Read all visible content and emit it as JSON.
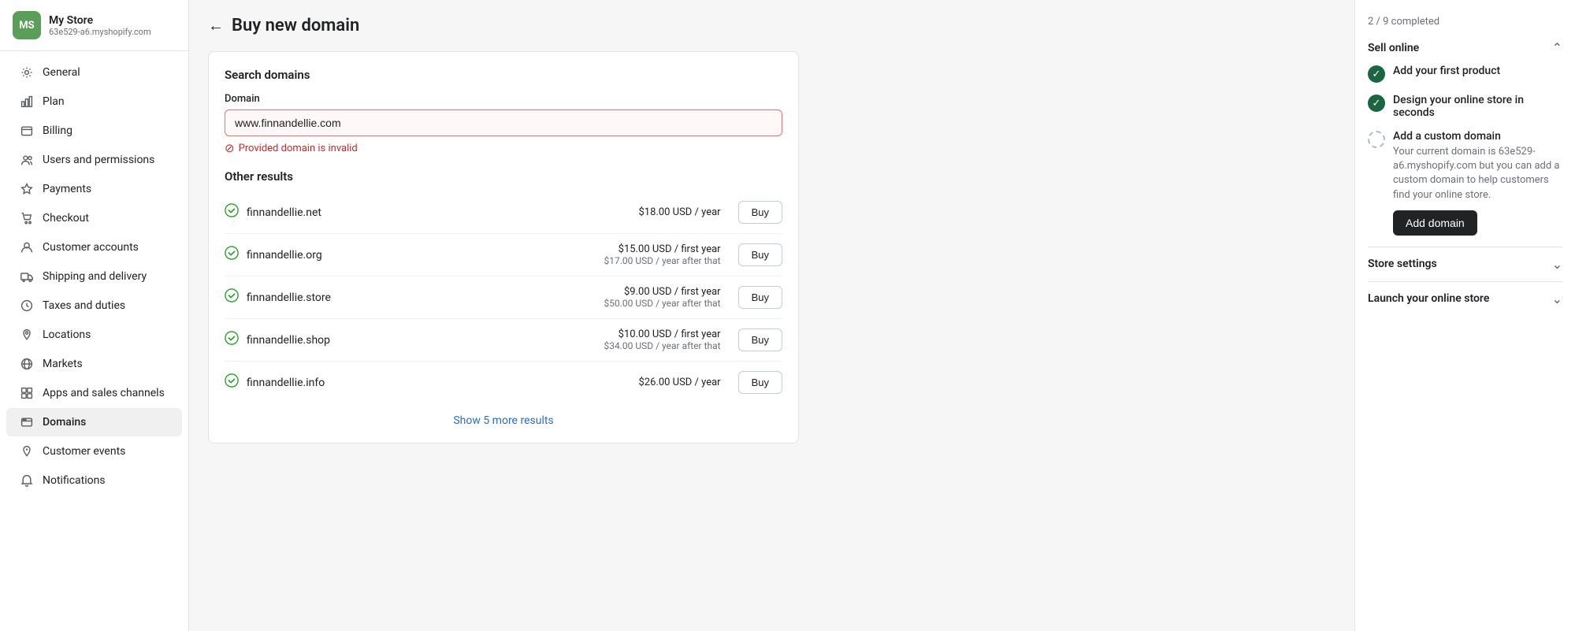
{
  "store": {
    "initials": "MS",
    "name": "My Store",
    "url": "63e529-a6.myshopify.com"
  },
  "sidebar": {
    "items": [
      {
        "id": "general",
        "label": "General",
        "icon": "gear"
      },
      {
        "id": "plan",
        "label": "Plan",
        "icon": "chart"
      },
      {
        "id": "billing",
        "label": "Billing",
        "icon": "billing"
      },
      {
        "id": "users",
        "label": "Users and permissions",
        "icon": "users"
      },
      {
        "id": "payments",
        "label": "Payments",
        "icon": "payments"
      },
      {
        "id": "checkout",
        "label": "Checkout",
        "icon": "checkout"
      },
      {
        "id": "customer-accounts",
        "label": "Customer accounts",
        "icon": "customer-accounts"
      },
      {
        "id": "shipping",
        "label": "Shipping and delivery",
        "icon": "shipping"
      },
      {
        "id": "taxes",
        "label": "Taxes and duties",
        "icon": "taxes"
      },
      {
        "id": "locations",
        "label": "Locations",
        "icon": "locations"
      },
      {
        "id": "markets",
        "label": "Markets",
        "icon": "markets"
      },
      {
        "id": "apps",
        "label": "Apps and sales channels",
        "icon": "apps"
      },
      {
        "id": "domains",
        "label": "Domains",
        "icon": "domains",
        "active": true
      },
      {
        "id": "customer-events",
        "label": "Customer events",
        "icon": "customer-events"
      },
      {
        "id": "notifications",
        "label": "Notifications",
        "icon": "notifications"
      }
    ]
  },
  "page": {
    "title": "Buy new domain",
    "back_label": "←"
  },
  "search_section": {
    "title": "Search domains",
    "field_label": "Domain",
    "input_value": "www.finnandellie.com",
    "input_placeholder": "www.finnandellie.com",
    "error_message": "Provided domain is invalid"
  },
  "other_results": {
    "title": "Other results",
    "items": [
      {
        "domain": "finnandellie.net",
        "price_main": "$18.00 USD / year",
        "price_sub": "",
        "buy_label": "Buy"
      },
      {
        "domain": "finnandellie.org",
        "price_main": "$15.00 USD / first year",
        "price_sub": "$17.00 USD / year after that",
        "buy_label": "Buy"
      },
      {
        "domain": "finnandellie.store",
        "price_main": "$9.00 USD / first year",
        "price_sub": "$50.00 USD / year after that",
        "buy_label": "Buy"
      },
      {
        "domain": "finnandellie.shop",
        "price_main": "$10.00 USD / first year",
        "price_sub": "$34.00 USD / year after that",
        "buy_label": "Buy"
      },
      {
        "domain": "finnandellie.info",
        "price_main": "$26.00 USD / year",
        "price_sub": "",
        "buy_label": "Buy"
      }
    ],
    "show_more_label": "Show 5 more results"
  },
  "right_panel": {
    "progress_text": "2 / 9 completed",
    "sell_online": {
      "title": "Sell online",
      "tasks": [
        {
          "id": "first-product",
          "label": "Add your first product",
          "done": true
        },
        {
          "id": "design-store",
          "label": "Design your online store in seconds",
          "done": true
        },
        {
          "id": "custom-domain",
          "label": "Add a custom domain",
          "done": false,
          "description": "Your current domain is 63e529-a6.myshopify.com but you can add a custom domain to help customers find your online store.",
          "cta_label": "Add domain"
        }
      ]
    },
    "store_settings": {
      "title": "Store settings"
    },
    "launch_store": {
      "title": "Launch your online store"
    }
  }
}
